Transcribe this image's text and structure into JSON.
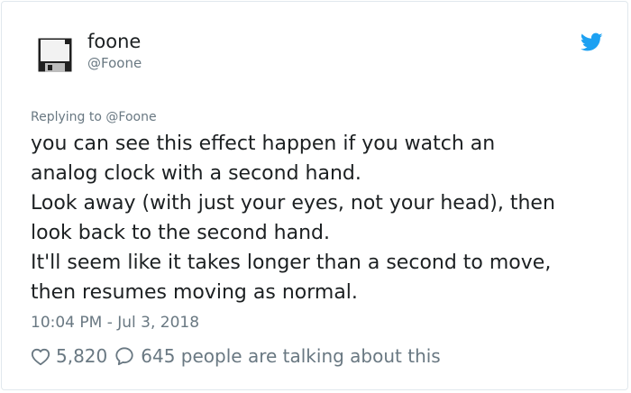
{
  "author": {
    "display_name": "foone",
    "handle": "@Foone",
    "avatar_icon": "floppy-disk-icon"
  },
  "platform_icon": "twitter-bird-icon",
  "reply": {
    "prefix": "Replying to",
    "mention": "@Foone"
  },
  "tweet": {
    "lines": [
      "you can see this effect happen if you watch an",
      "analog clock with a second hand.",
      "Look away (with just your eyes, not your head), then",
      "look back to the second hand.",
      "It'll seem like it takes longer than a second to move,",
      "then resumes moving as normal."
    ]
  },
  "timestamp": "10:04 PM - Jul 3, 2018",
  "engagement": {
    "like_icon": "heart-icon",
    "likes": "5,820",
    "comment_icon": "speech-bubble-icon",
    "talking_text": "645 people are talking about this"
  },
  "colors": {
    "text": "#1c2022",
    "muted": "#697882",
    "twitter_blue": "#1da1f2",
    "border": "#e1e8ed"
  }
}
